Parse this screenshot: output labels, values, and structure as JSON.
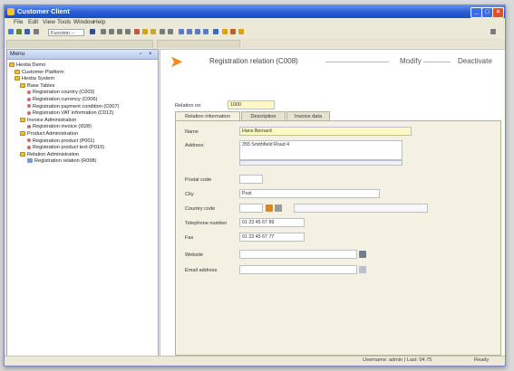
{
  "window": {
    "title": "Customer Client"
  },
  "menubar": [
    "File",
    "Edit",
    "View",
    "Tools",
    "Window",
    "Help"
  ],
  "toolbar": {
    "combo_value": "Function --"
  },
  "menu_panel": {
    "title": "Menu",
    "tree": [
      {
        "label": "Hestia Demo",
        "icon": "folder-icon"
      },
      {
        "label": "Customer Platform",
        "icon": "folder-icon"
      },
      {
        "label": "Hestia System",
        "icon": "folder-icon"
      },
      {
        "label": "Base Tables",
        "icon": "folder-icon"
      },
      {
        "label": "Registration country (C003)",
        "icon": "doc-icon"
      },
      {
        "label": "Registration currency (C006)",
        "icon": "doc-icon"
      },
      {
        "label": "Registration payment condition (C007)",
        "icon": "doc-icon"
      },
      {
        "label": "Registration VAT information (C012)",
        "icon": "doc-icon"
      },
      {
        "label": "Invoice Administration",
        "icon": "folder-icon"
      },
      {
        "label": "Registration invoice (I028)",
        "icon": "doc-icon"
      },
      {
        "label": "Product Administration",
        "icon": "folder-icon"
      },
      {
        "label": "Registration product (P001)",
        "icon": "doc-icon"
      },
      {
        "label": "Registration product text (P010)",
        "icon": "doc-icon"
      },
      {
        "label": "Relation Administration",
        "icon": "folder-icon"
      },
      {
        "label": "Registration relation (R008)",
        "icon": "pkg-icon"
      }
    ]
  },
  "main": {
    "title": "Registration relation (C008)",
    "links": [
      "Modify",
      "Deactivate"
    ],
    "reference": {
      "label": "Relation no",
      "value": "1000"
    },
    "tabs": [
      "Relation information",
      "Description",
      "Invoice data"
    ],
    "fields": {
      "name_label": "Name",
      "name_value": "Hans Bernard",
      "address_label": "Address",
      "address_value": "355 Smithfield Road 4",
      "postcode_label": "Postal code",
      "postcode_value": "",
      "city_label": "City",
      "city_value": "Post",
      "country_label": "Country code",
      "country_value": "",
      "phone_label": "Telephone number",
      "phone_value": "01 23 45 67 89",
      "fax_label": "Fax",
      "fax_value": "01 23 45 67 77",
      "website_label": "Website",
      "website_value": "",
      "email_label": "Email address",
      "email_value": ""
    }
  },
  "status": {
    "text": "Username: admin | Last: 04.75",
    "field": "Ready"
  }
}
